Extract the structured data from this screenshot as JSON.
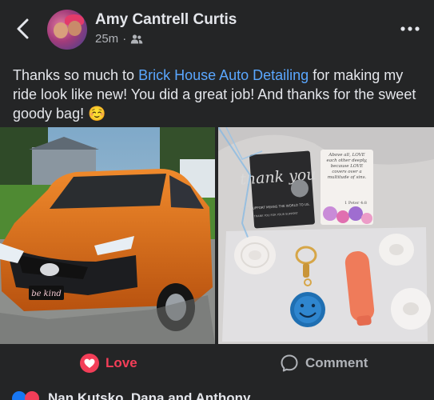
{
  "header": {
    "author_name": "Amy Cantrell Curtis",
    "time_ago": "25m",
    "separator": "·",
    "audience_icon": "friends-icon",
    "back_icon": "chevron-left-icon",
    "more_icon": "more-horizontal-icon"
  },
  "post": {
    "text_before": "Thanks so much to ",
    "link_text": "Brick House Auto Detailing",
    "text_after": " for making my ride look like new! You did a great job! And thanks for the sweet goody bag! ",
    "emoji": "☺️"
  },
  "photos": {
    "left": {
      "plate_text": "be kind"
    },
    "right": {
      "card_word": "thank you",
      "card_small_text": "YOUR SUPPORT MEANS THE WORLD TO US.",
      "card_small_text2": "THANK YOU FOR YOUR SUPPORT",
      "verse_text": "Above all, LOVE each other deeply, because LOVE covers over a multitude of sins.",
      "verse_ref": "1 Peter 4:8"
    }
  },
  "actions": {
    "love_label": "Love",
    "comment_label": "Comment"
  },
  "next_post": {
    "names": "Nan Kutsko, Dana and Anthony"
  },
  "colors": {
    "background": "#242526",
    "link": "#5aa7ff",
    "love": "#f33e58",
    "secondary_text": "#b0b3b8",
    "car_orange": "#e0701c"
  }
}
